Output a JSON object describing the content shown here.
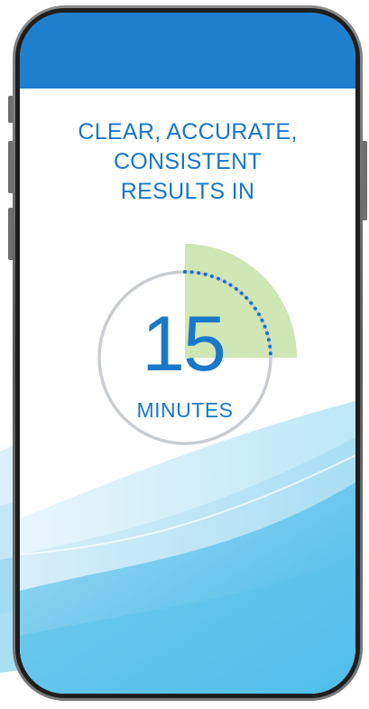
{
  "colors": {
    "header_bar": "#1f7fcf",
    "headline_text": "#1776c9",
    "timer_ring": "#c9cdd2",
    "timer_progress_dots": "#1a73c4",
    "timer_sector": "#cfe6b5",
    "number_text": "#1a78c8",
    "wave_light": "#bfe6f6",
    "wave_mid": "#7ccbee",
    "wave_dark": "#2fb3e6"
  },
  "headline": {
    "line1": "CLEAR, ACCURATE,",
    "line2": "CONSISTENT",
    "line3": "RESULTS IN"
  },
  "timer": {
    "value": "15",
    "unit": "MINUTES",
    "progress_fraction": 0.25
  },
  "icons": {
    "timer_sector": "quarter-sector-icon",
    "timer_progress": "dotted-arc-icon"
  }
}
